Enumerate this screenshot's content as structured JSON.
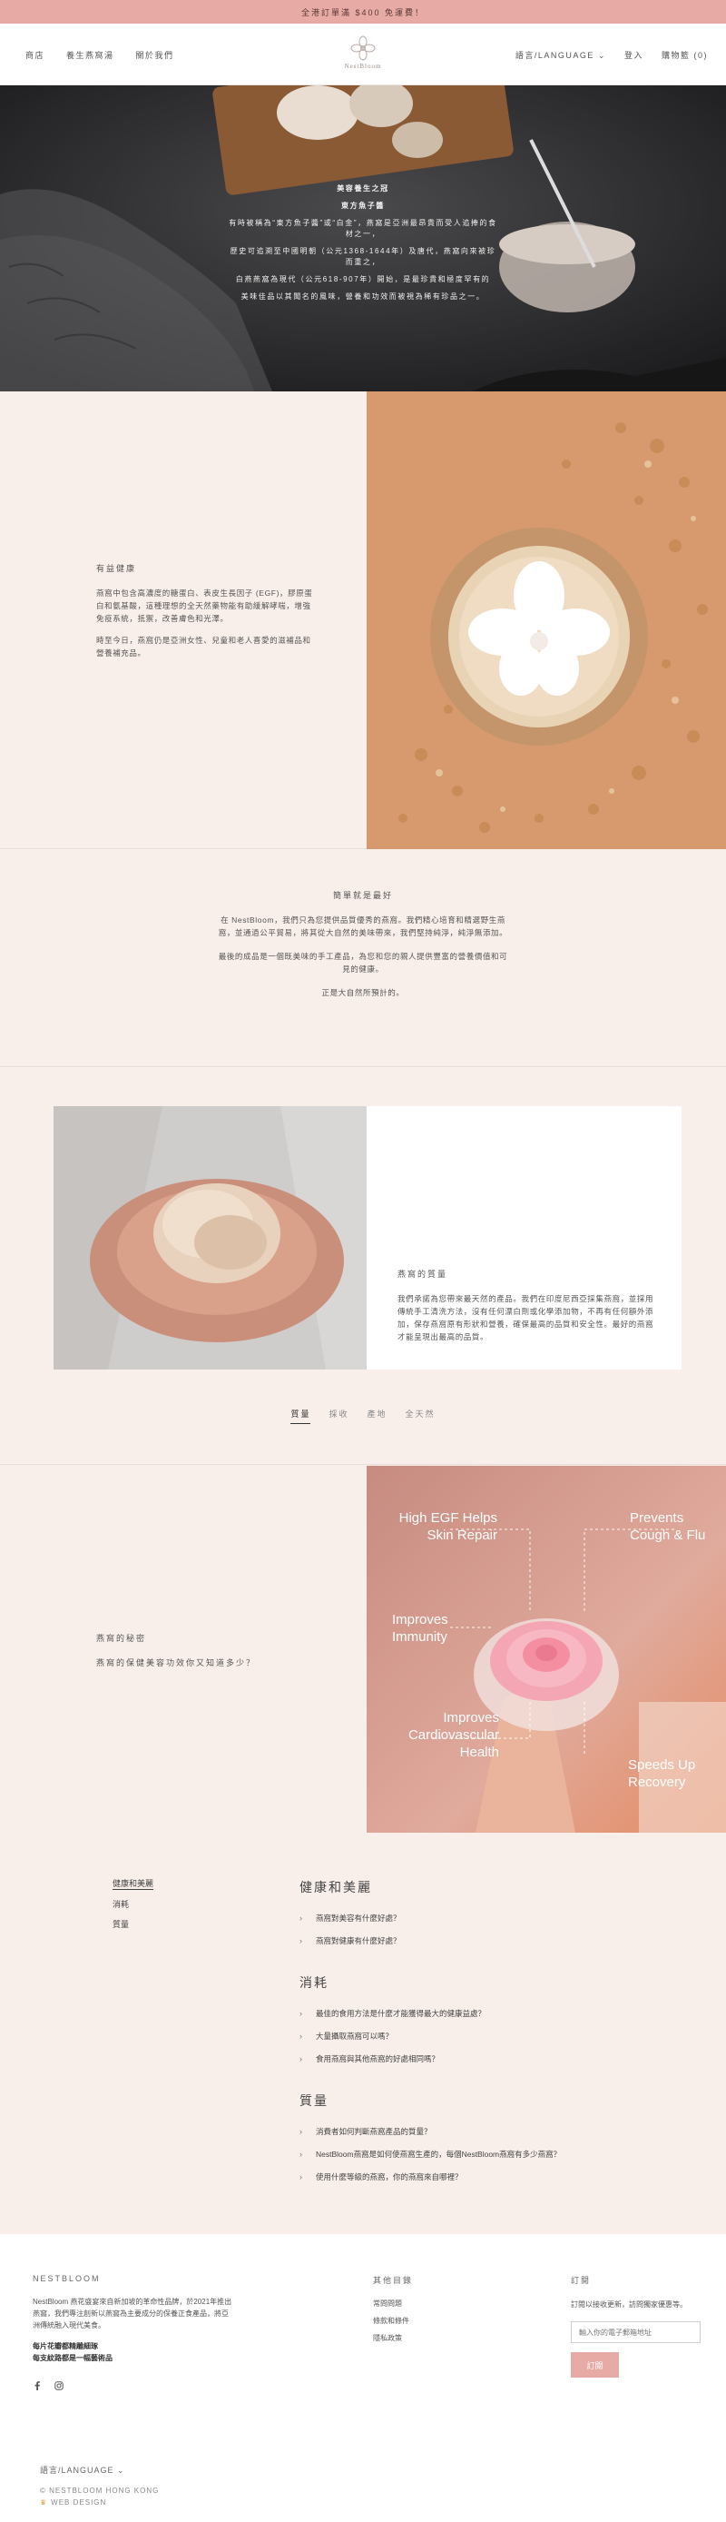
{
  "announcement": "全港訂單滿 $400 免運費！",
  "header": {
    "nav_left": [
      "商店",
      "養生燕窩湯",
      "關於我們"
    ],
    "language": "語言/LANGUAGE",
    "login": "登入",
    "cart": "購物籃 (0)",
    "logo_text": "NestBloom"
  },
  "hero": {
    "lines": [
      "美容養生之冠",
      "東方魚子醬",
      "有時被稱為“東方魚子醬”或“白金”，燕窩是亞洲最昂貴而受人追捧的食材之一，",
      "歷史可追溯至中國明朝（公元1368-1644年）及唐代，燕窩向來被珍而重之，",
      "白燕燕窩為現代（公元618-907年）開始，是最珍貴和極度罕有的",
      "美味佳品以其聞名的風味，營養和功效而被視為稀有珍品之一。"
    ]
  },
  "section_health": {
    "title": "有益健康",
    "paragraphs": [
      "燕窩中包含高濃度的糖蛋白、表皮生長因子 (EGF)，膠原蛋白和氨基酸，這種理想的全天然藥物能有助緩解哮喘，增強免疫系統，抵禦，改善膚色和光澤。",
      "時至今日，燕窩仍是亞洲女性、兒童和老人喜愛的滋補品和營養補充品。"
    ]
  },
  "section_simple": {
    "title": "簡單就是最好",
    "paragraphs": [
      "在 NestBloom，我們只為您提供品質優秀的燕窩。我們精心培育和精選野生燕窩，並通過公平貿易，將其從大自然的美味帶來，我們堅持純淨，純淨無添加。",
      "最後的成品是一個既美味的手工產品，為您和您的親人提供豐富的營養價值和可見的健康。",
      "正是大自然所預計的。"
    ]
  },
  "section_quality": {
    "title": "燕窩的質量",
    "paragraph": "我們承諾為您帶來最天然的產品。我們在印度尼西亞採集燕窩，並採用傳統手工清洗方法，沒有任何漂白劑或化學添加物，不再有任何額外添加，保存燕窩原有形狀和營養，確保最高的品質和安全性。最好的燕窩才能呈現出最高的品質。",
    "tabs": [
      "質量",
      "採收",
      "產地",
      "全天然"
    ]
  },
  "section_secret": {
    "title": "燕窩的秘密",
    "subtitle": "燕窩的保健美容功效你又知道多少？",
    "image_labels": {
      "egf": "High EGF Helps\nSkin Repair",
      "cough": "Prevents\nCough & Flu",
      "immunity": "Improves\nImmunity",
      "cardio": "Improves\nCardiovascular\nHealth",
      "recovery": "Speeds Up\nRecovery"
    }
  },
  "faq": {
    "nav": [
      "健康和美麗",
      "消耗",
      "質量"
    ],
    "groups": [
      {
        "heading": "健康和美麗",
        "questions": [
          "燕窩對美容有什麼好處？",
          "燕窩對健康有什麼好處？"
        ]
      },
      {
        "heading": "消耗",
        "questions": [
          "最佳的食用方法是什麼才能獲得最大的健康益處？",
          "大量攝取燕窩可以嗎？",
          "食用燕窩與其他燕窩的好處相同嗎？"
        ]
      },
      {
        "heading": "質量",
        "questions": [
          "消費者如何判斷燕窩產品的質量？",
          "NestBloom燕窩是如何使燕窩生產的，每個NestBloom燕窩有多少燕窩？",
          "使用什麼等級的燕窩，你的燕窩來自哪裡？"
        ]
      }
    ]
  },
  "footer": {
    "brand_title": "NESTBLOOM",
    "brand_text": "NestBloom 燕花盛宴來自新加坡的革命性品牌，於2021年推出燕窩，我們專注創新以燕窩為主要成分的保養正食產品，將亞洲傳統融入現代美食。",
    "brand_bold_1": "每片花瓣都精雕細琢",
    "brand_bold_2": "每支紋路都是一幅藝術品",
    "links_title": "其他目錄",
    "links": [
      "常問問題",
      "條款和條件",
      "隱私政策"
    ],
    "subscribe_title": "訂閱",
    "subscribe_text": "訂閱以接收更新，訪問獨家優惠等。",
    "email_placeholder": "輸入你的電子郵箱地址",
    "subscribe_button": "訂閱",
    "language": "語言/LANGUAGE",
    "copyright": "© NESTBLOOM HONG KONG",
    "web_design": "WEB DESIGN"
  }
}
